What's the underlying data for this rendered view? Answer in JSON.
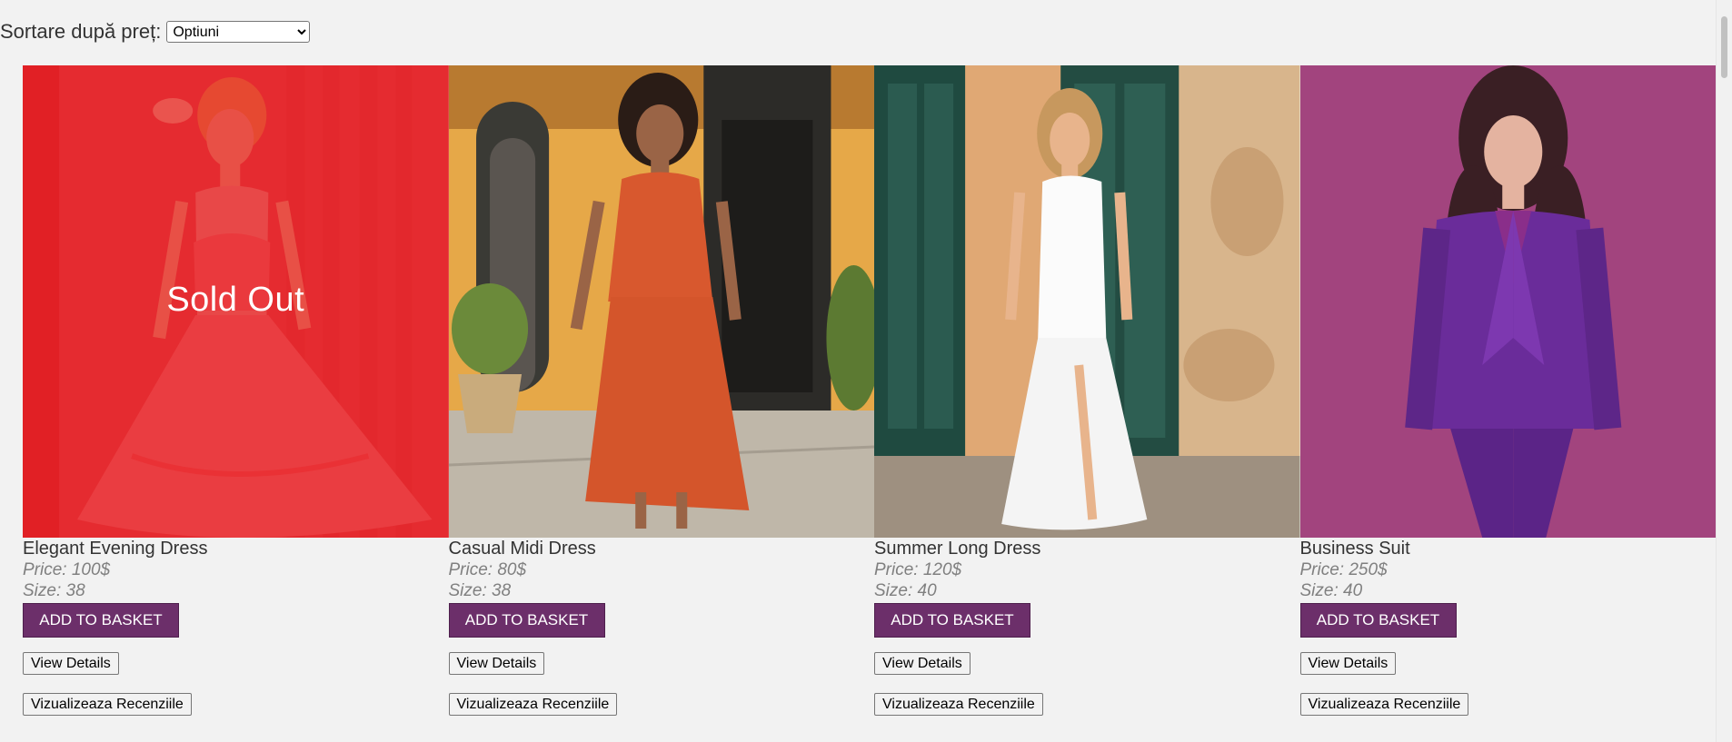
{
  "sort": {
    "label": "Sortare după preț:",
    "selected": "Optiuni"
  },
  "products": [
    {
      "name": "Elegant Evening Dress",
      "price": "Price: 100$",
      "size": "Size: 38",
      "sold_out": true,
      "sold_out_label": "Sold Out",
      "add_label": "ADD TO BASKET",
      "details_label": "View Details",
      "reviews_label": "Vizualizeaza Recenziile",
      "image_icon": "pink-dress-photo"
    },
    {
      "name": "Casual Midi Dress",
      "price": "Price: 80$",
      "size": "Size: 38",
      "sold_out": false,
      "add_label": "ADD TO BASKET",
      "details_label": "View Details",
      "reviews_label": "Vizualizeaza Recenziile",
      "image_icon": "orange-midi-dress-photo"
    },
    {
      "name": "Summer Long Dress",
      "price": "Price: 120$",
      "size": "Size: 40",
      "sold_out": false,
      "add_label": "ADD TO BASKET",
      "details_label": "View Details",
      "reviews_label": "Vizualizeaza Recenziile",
      "image_icon": "white-long-dress-photo"
    },
    {
      "name": "Business Suit",
      "price": "Price: 250$",
      "size": "Size: 40",
      "sold_out": false,
      "add_label": "ADD TO BASKET",
      "details_label": "View Details",
      "reviews_label": "Vizualizeaza Recenziile",
      "image_icon": "purple-suit-photo"
    }
  ],
  "colors": {
    "background": "#f2f2f2",
    "button_primary": "#6c2f6a",
    "sold_out_overlay": "#dc0000"
  }
}
